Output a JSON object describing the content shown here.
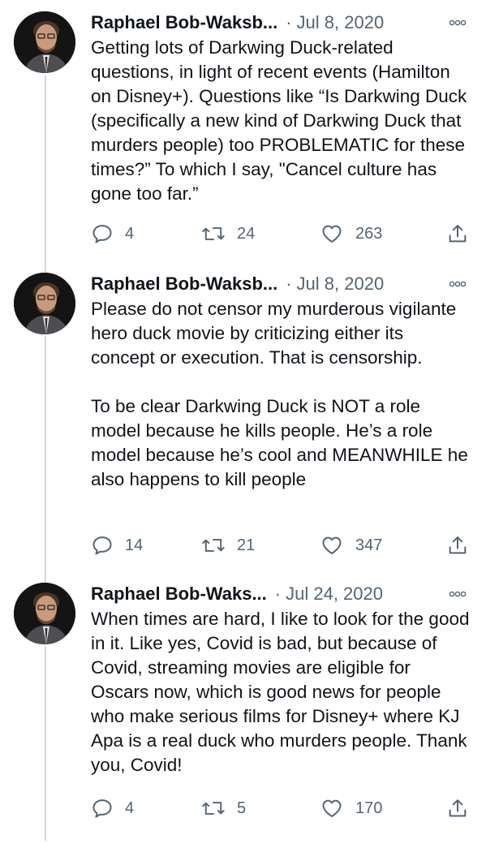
{
  "tweets": [
    {
      "author": "Raphael Bob-Waksb...",
      "date": "Jul 8, 2020",
      "text": "Getting lots of Darkwing Duck-related questions, in light of recent events (Hamilton on Disney+). Questions like “Is Darkwing Duck (specifically a new kind of Darkwing Duck that murders people) too PROBLEMATIC for these times?” To which I say, \"Cancel culture has gone too far.”",
      "replies": "4",
      "retweets": "24",
      "likes": "263"
    },
    {
      "author": "Raphael Bob-Waksb...",
      "date": "Jul 8, 2020",
      "text": "Please do not censor my murderous vigilante hero duck movie by criticizing either its concept or execution. That is censorship.\n\nTo be clear Darkwing Duck is NOT a role model because he kills people. He’s a role model because he’s cool and MEANWHILE he also happens to kill people",
      "replies": "14",
      "retweets": "21",
      "likes": "347"
    },
    {
      "author": "Raphael Bob-Waks...",
      "date": "Jul 24, 2020",
      "text": "When times are hard, I like to look for the good in it. Like yes, Covid is bad, but because of Covid, streaming movies are eligible for Oscars now, which is good news for people who make serious films for Disney+ where KJ Apa is a real duck who murders people. Thank you, Covid!",
      "replies": "4",
      "retweets": "5",
      "likes": "170"
    }
  ],
  "separator": "·",
  "icons": {
    "reply": "reply-icon",
    "retweet": "retweet-icon",
    "like": "heart-icon",
    "share": "share-icon",
    "more": "more-options-icon"
  },
  "colors": {
    "text": "#0f1419",
    "secondary": "#536471",
    "thread_line": "#cfd9de"
  }
}
